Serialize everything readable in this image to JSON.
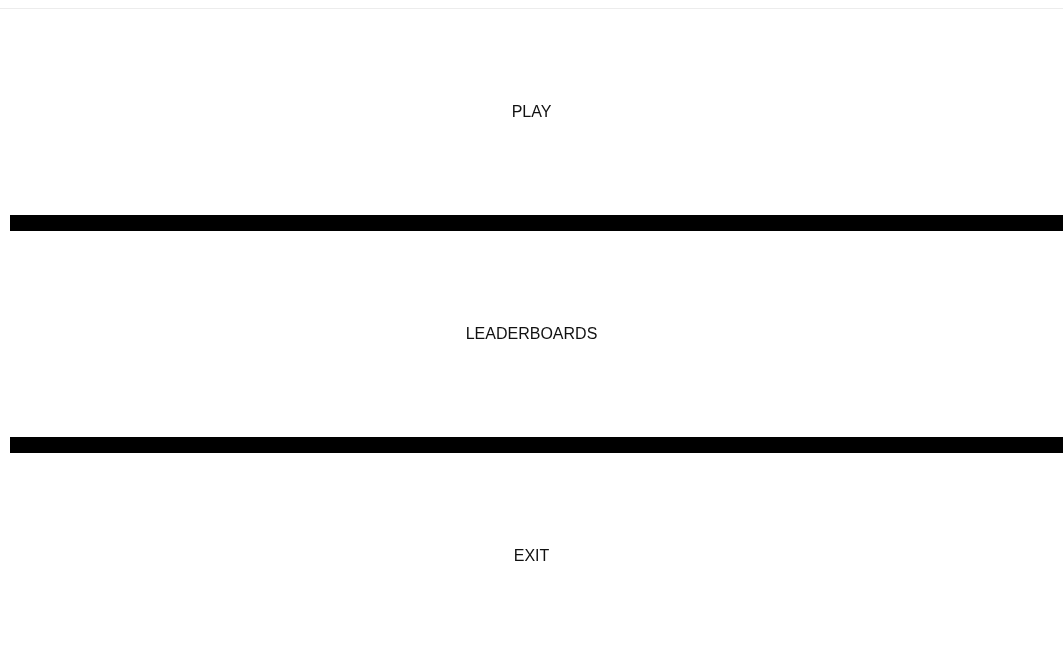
{
  "menu": [
    {
      "label": "PLAY"
    },
    {
      "label": "LEADERBOARDS"
    },
    {
      "label": "EXIT"
    }
  ]
}
